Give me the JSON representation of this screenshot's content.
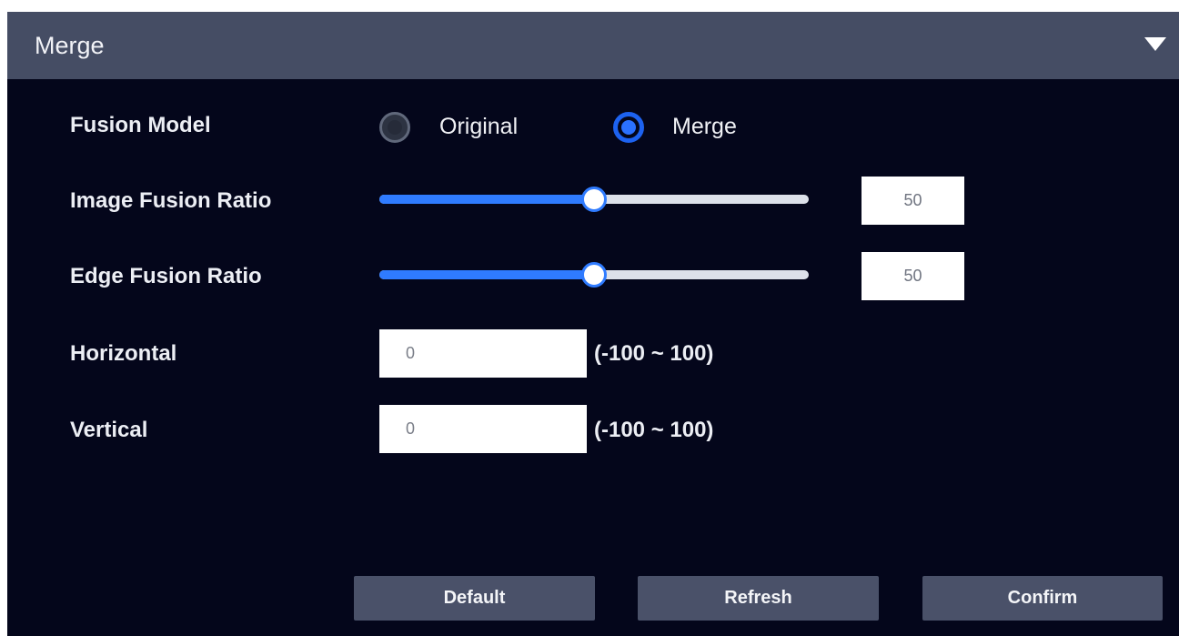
{
  "header": {
    "title": "Merge",
    "collapse_icon": "triangle-down-icon"
  },
  "fusion_model": {
    "label": "Fusion Model",
    "options": [
      {
        "label": "Original",
        "selected": false
      },
      {
        "label": "Merge",
        "selected": true
      }
    ]
  },
  "image_fusion_ratio": {
    "label": "Image Fusion Ratio",
    "value": "50",
    "min": 0,
    "max": 100
  },
  "edge_fusion_ratio": {
    "label": "Edge Fusion Ratio",
    "value": "50",
    "min": 0,
    "max": 100
  },
  "horizontal": {
    "label": "Horizontal",
    "value": "0",
    "range": "(-100 ~ 100)"
  },
  "vertical": {
    "label": "Vertical",
    "value": "0",
    "range": "(-100 ~ 100)"
  },
  "buttons": {
    "default_label": "Default",
    "refresh_label": "Refresh",
    "confirm_label": "Confirm"
  },
  "colors": {
    "panel_bg": "#04061b",
    "header_bg": "#454d64",
    "accent": "#2f7bff",
    "button_bg": "#4a5169"
  }
}
